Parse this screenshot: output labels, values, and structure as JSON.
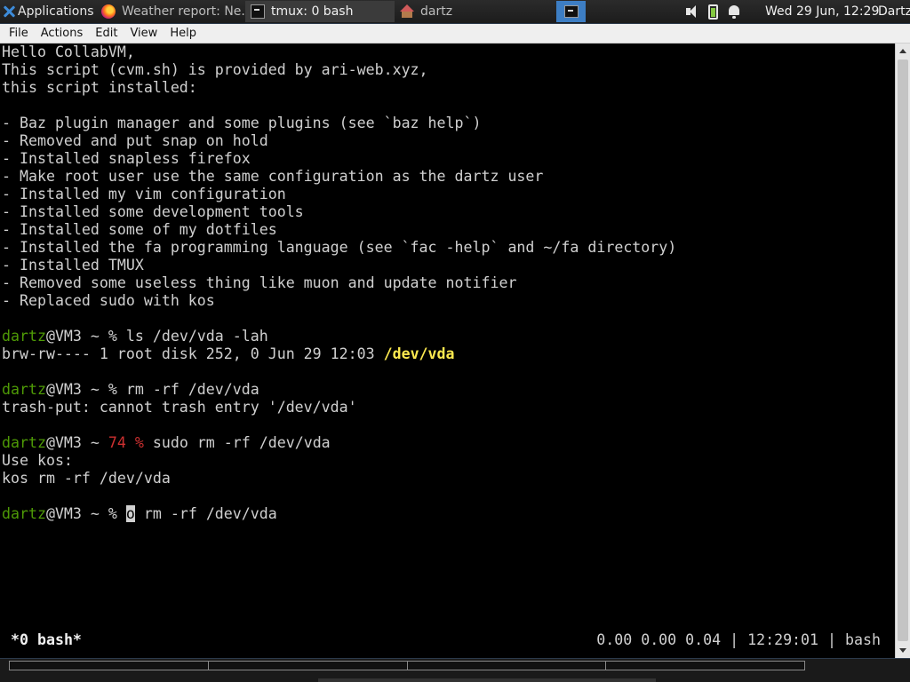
{
  "panel": {
    "applications_label": "Applications",
    "tasks": [
      {
        "label": "Weather report: Ne...",
        "icon": "firefox-icon"
      },
      {
        "label": "tmux: 0 bash",
        "icon": "terminal-icon"
      },
      {
        "label": "dartz",
        "icon": "home-folder-icon"
      }
    ],
    "clock": "Wed 29 Jun, 12:29",
    "user": "Dartz"
  },
  "menubar": {
    "items": [
      "File",
      "Actions",
      "Edit",
      "View",
      "Help"
    ]
  },
  "terminal": {
    "lines": [
      "Hello CollabVM,",
      "This script (cvm.sh) is provided by ari-web.xyz,",
      "this script installed:",
      "",
      "- Baz plugin manager and some plugins (see `baz help`)",
      "- Removed and put snap on hold",
      "- Installed snapless firefox",
      "- Make root user use the same configuration as the dartz user",
      "- Installed my vim configuration",
      "- Installed some development tools",
      "- Installed some of my dotfiles",
      "- Installed the fa programming language (see `fac -help` and ~/fa directory)",
      "- Installed TMUX",
      "- Removed some useless thing like muon and update notifier",
      "- Replaced sudo with kos",
      ""
    ],
    "prompt_user": "dartz",
    "prompt_host": "@VM3 ~ ",
    "prompt_symbol": "%",
    "prompt_error_code": "74",
    "cmd1": " ls /dev/vda -lah",
    "out1_prefix": "brw-rw---- 1 root disk 252, 0 Jun 29 12:03 ",
    "out1_path": "/dev/vda",
    "cmd2": " rm -rf /dev/vda",
    "out2": "trash-put: cannot trash entry '/dev/vda'",
    "cmd3": " sudo rm -rf /dev/vda",
    "out3a": "Use kos:",
    "out3b": "kos rm -rf /dev/vda",
    "cursor_char": "o",
    "cmd4_rest": " rm -rf /dev/vda"
  },
  "tmux": {
    "window": "*0 bash*",
    "load": "0.00 0.00 0.04",
    "time": "12:29:01",
    "session": "bash",
    "separator": " | "
  }
}
